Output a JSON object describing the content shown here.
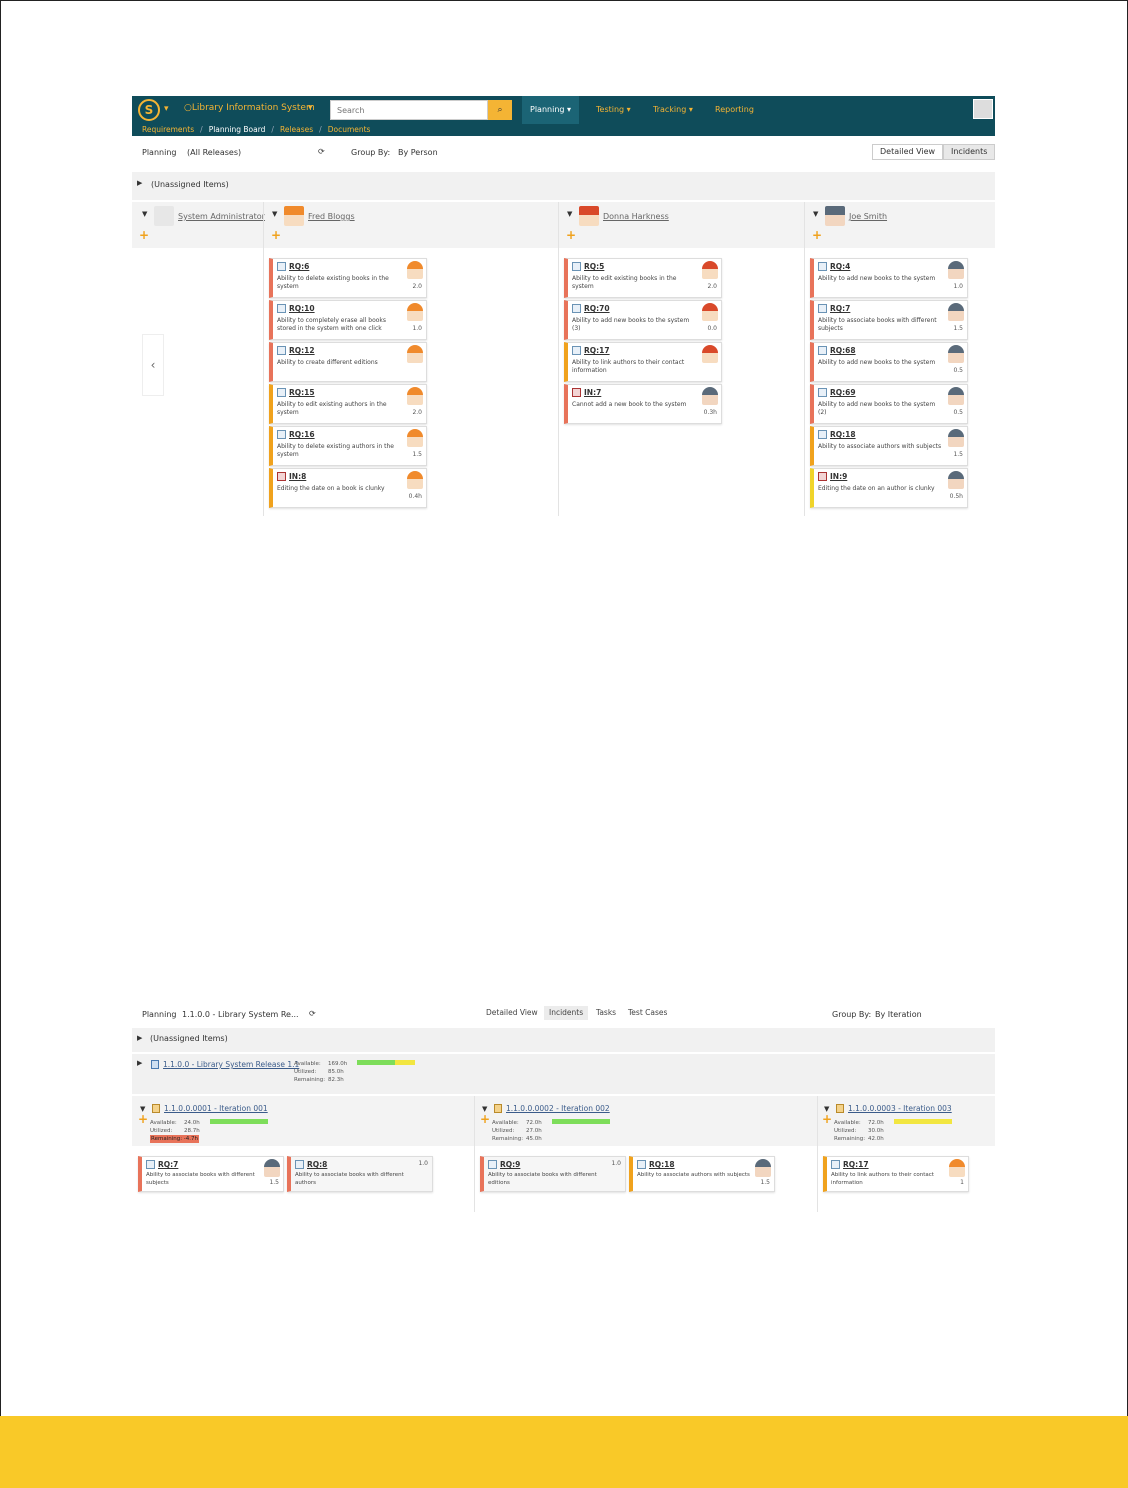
{
  "board1": {
    "project": "Library Information System",
    "search_placeholder": "Search",
    "nav": [
      "Planning",
      "Testing",
      "Tracking",
      "Reporting"
    ],
    "breadcrumb": [
      "Requirements",
      "Planning Board",
      "Releases",
      "Documents"
    ],
    "planning_label": "Planning",
    "planning_value": "(All Releases)",
    "group_by_label": "Group By:",
    "group_by_value": "By Person",
    "views": [
      "Detailed View",
      "Incidents"
    ],
    "unassigned": "(Unassigned Items)",
    "people": [
      "System Administrator",
      "Fred Bloggs",
      "Donna Harkness",
      "Joe Smith"
    ],
    "columns": [
      {
        "cards": [
          {
            "id": "RQ:6",
            "desc": "Ability to delete existing books in the system",
            "est": "2.0",
            "color": "#e8735a",
            "type": "req"
          },
          {
            "id": "RQ:10",
            "desc": "Ability to completely erase all books stored in the system with one click",
            "est": "1.0",
            "color": "#e8735a",
            "type": "req"
          },
          {
            "id": "RQ:12",
            "desc": "Ability to create different editions",
            "est": "",
            "color": "#e8735a",
            "type": "req"
          },
          {
            "id": "RQ:15",
            "desc": "Ability to edit existing authors in the system",
            "est": "2.0",
            "color": "#f0a21d",
            "type": "req"
          },
          {
            "id": "RQ:16",
            "desc": "Ability to delete existing authors in the system",
            "est": "1.5",
            "color": "#f0a21d",
            "type": "req"
          },
          {
            "id": "IN:8",
            "desc": "Editing the date on a book is clunky",
            "est": "0.4h",
            "color": "#f0a21d",
            "type": "inc"
          }
        ]
      },
      {
        "cards": [
          {
            "id": "RQ:5",
            "desc": "Ability to edit existing books in the system",
            "est": "2.0",
            "color": "#e8735a",
            "type": "req"
          },
          {
            "id": "RQ:70",
            "desc": "Ability to add new books to the system (3)",
            "est": "0.0",
            "color": "#e8735a",
            "type": "req"
          },
          {
            "id": "RQ:17",
            "desc": "Ability to link authors to their contact information",
            "est": "",
            "color": "#f0a21d",
            "type": "req"
          },
          {
            "id": "IN:7",
            "desc": "Cannot add a new book to the system",
            "est": "0.3h",
            "color": "#e8735a",
            "type": "inc"
          }
        ]
      },
      {
        "cards": [
          {
            "id": "RQ:4",
            "desc": "Ability to add new books to the system",
            "est": "1.0",
            "color": "#e8735a",
            "type": "req"
          },
          {
            "id": "RQ:7",
            "desc": "Ability to associate books with different subjects",
            "est": "1.5",
            "color": "#e8735a",
            "type": "req"
          },
          {
            "id": "RQ:68",
            "desc": "Ability to add new books to the system",
            "est": "0.5",
            "color": "#e8735a",
            "type": "req"
          },
          {
            "id": "RQ:69",
            "desc": "Ability to add new books to the system (2)",
            "est": "0.5",
            "color": "#e8735a",
            "type": "req"
          },
          {
            "id": "RQ:18",
            "desc": "Ability to associate authors with subjects",
            "est": "1.5",
            "color": "#f0a21d",
            "type": "req"
          },
          {
            "id": "IN:9",
            "desc": "Editing the date on an author is clunky",
            "est": "0.5h",
            "color": "#f0d42a",
            "type": "inc"
          }
        ]
      }
    ]
  },
  "board2": {
    "planning_label": "Planning",
    "planning_value": "1.1.0.0 - Library System Re...",
    "tabs": [
      "Detailed View",
      "Incidents",
      "Tasks",
      "Test Cases"
    ],
    "group_by_label": "Group By:",
    "group_by_value": "By Iteration",
    "unassigned": "(Unassigned Items)",
    "release": {
      "name": "1.1.0.0 - Library System Release 1.1",
      "labels": [
        "Available:",
        "Utilized:",
        "Remaining:"
      ],
      "values": [
        "169.0h",
        "85.0h",
        "82.3h"
      ],
      "utilization": 0.65
    },
    "iterations": [
      {
        "name": "1.1.0.0.0001 - Iteration 001",
        "labels": [
          "Available:",
          "Utilized:"
        ],
        "remaining_label": "Remaining: -4.7h",
        "values": [
          "24.0h",
          "28.7h"
        ],
        "utilization": 1.0,
        "bar_color": "#7ddd5a",
        "cards": [
          {
            "id": "RQ:7",
            "desc": "Ability to associate books with different subjects",
            "est": "1.5",
            "color": "#e8735a",
            "gray": false
          },
          {
            "id": "RQ:8",
            "desc": "Ability to associate books with different authors",
            "est": "1.0",
            "color": "#e8735a",
            "gray": true
          }
        ]
      },
      {
        "name": "1.1.0.0.0002 - Iteration 002",
        "labels": [
          "Available:",
          "Utilized:",
          "Remaining:"
        ],
        "remaining_label": "",
        "values": [
          "72.0h",
          "27.0h",
          "45.0h"
        ],
        "utilization": 1.0,
        "bar_color": "#7ddd5a",
        "cards": [
          {
            "id": "RQ:9",
            "desc": "Ability to associate books with different editions",
            "est": "1.0",
            "color": "#e8735a",
            "gray": true
          },
          {
            "id": "RQ:18",
            "desc": "Ability to associate authors with subjects",
            "est": "1.5",
            "color": "#f0a21d",
            "gray": false
          }
        ]
      },
      {
        "name": "1.1.0.0.0003 - Iteration 003",
        "labels": [
          "Available:",
          "Utilized:",
          "Remaining:"
        ],
        "remaining_label": "",
        "values": [
          "72.0h",
          "30.0h",
          "42.0h"
        ],
        "utilization": 1.0,
        "bar_color": "#f2e640",
        "cards": [
          {
            "id": "RQ:17",
            "desc": "Ability to link authors to their contact information",
            "est": "1",
            "color": "#f0a21d",
            "gray": false
          }
        ]
      }
    ]
  }
}
